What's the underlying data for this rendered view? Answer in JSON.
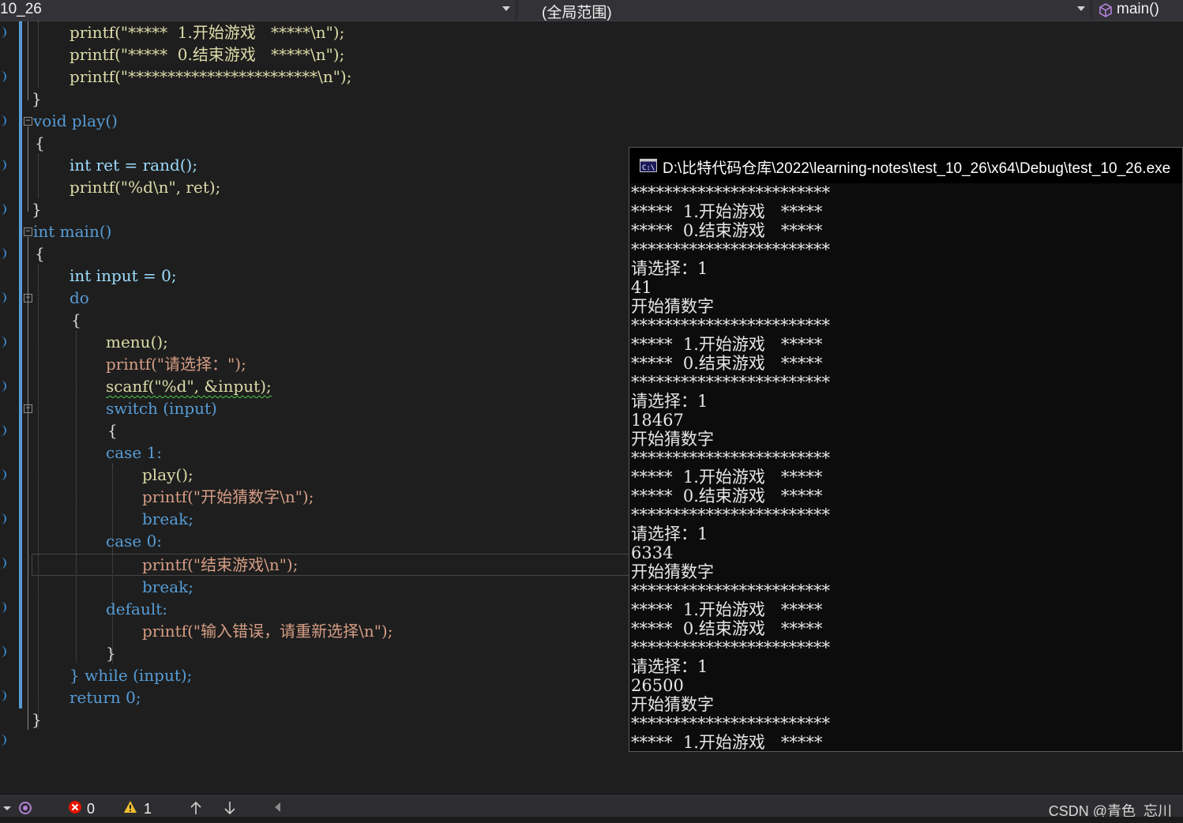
{
  "navbar": {
    "file_scope": "10_26",
    "global_scope": "(全局范围)",
    "member": "main()"
  },
  "code_lines": [
    "printf(\"*****  1.开始游戏   *****\\n\");",
    "printf(\"*****  0.结束游戏   *****\\n\");",
    "printf(\"************************\\n\");",
    "}",
    "void play()",
    "{",
    "int ret = rand();",
    "printf(\"%d\\n\", ret);",
    "}",
    "int main()",
    "{",
    "int input = 0;",
    "do",
    "{",
    "menu();",
    "printf(\"请选择：\");",
    "scanf(\"%d\", &input);",
    "switch (input)",
    "{",
    "case 1:",
    "play();",
    "printf(\"开始猜数字\\n\");",
    "break;",
    "case 0:",
    "printf(\"结束游戏\\n\");",
    "break;",
    "default:",
    "printf(\"输入错误，请重新选择\\n\");",
    "}",
    "} while (input);",
    "return 0;",
    "}"
  ],
  "console": {
    "title": "D:\\比特代码仓库\\2022\\learning-notes\\test_10_26\\x64\\Debug\\test_10_26.exe",
    "icon_label": "C:\\",
    "lines": [
      "************************",
      "*****  1.开始游戏   *****",
      "*****  0.结束游戏   *****",
      "************************",
      "请选择：1",
      "41",
      "开始猜数字",
      "************************",
      "*****  1.开始游戏   *****",
      "*****  0.结束游戏   *****",
      "************************",
      "请选择：1",
      "18467",
      "开始猜数字",
      "************************",
      "*****  1.开始游戏   *****",
      "*****  0.结束游戏   *****",
      "************************",
      "请选择：1",
      "6334",
      "开始猜数字",
      "************************",
      "*****  1.开始游戏   *****",
      "*****  0.结束游戏   *****",
      "************************",
      "请选择：1",
      "26500",
      "开始猜数字",
      "************************",
      "*****  1.开始游戏   *****"
    ]
  },
  "statusbar": {
    "errors": "0",
    "warnings": "1",
    "watermark": "CSDN @青色_忘川"
  },
  "colors": {
    "keyword": "#569cd6",
    "function": "#dcdcaa",
    "variable": "#9cdcfe",
    "string": "#d69d85",
    "number": "#b5cea8"
  }
}
